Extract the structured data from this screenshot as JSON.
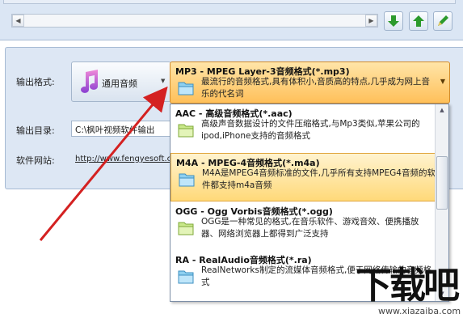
{
  "toolbar": {
    "icons": [
      "download-arrow-icon",
      "upload-arrow-icon",
      "edit-icon"
    ],
    "colors": {
      "green": "#2c9a2c"
    }
  },
  "settings": {
    "output_format_label": "输出格式:",
    "output_format_value": "通用音频",
    "output_dir_label": "输出目录:",
    "output_dir_value": "C:\\枫叶视频软件输出",
    "website_label": "软件网站:",
    "website_value": "http://www.fengyesoft.c"
  },
  "dropdown": {
    "selected": {
      "title": "MP3 - MPEG Layer-3音频格式(*.mp3)",
      "description": "最流行的音频格式,具有体积小,音质高的特点,几乎成为网上音乐的代名词"
    },
    "items": [
      {
        "title": "AAC - 高级音频格式(*.aac)",
        "description": "高级声音数据设计的文件压缩格式,与Mp3类似,苹果公司的ipod,iPhone支持的音频格式"
      },
      {
        "title": "M4A - MPEG-4音频格式(*.m4a)",
        "description": "M4A是MPEG4音频标准的文件,几乎所有支持MPEG4音频的软件都支持m4a音频"
      },
      {
        "title": "OGG - Ogg Vorbis音频格式(*.ogg)",
        "description": "OGG是一种常见的格式,在音乐软件、游戏音效、便携播放器、网络浏览器上都得到广泛支持"
      },
      {
        "title": "RA - RealAudio音频格式(*.ra)",
        "description": "RealNetworks制定的流媒体音频格式,便于网络传输的音频格式"
      }
    ]
  },
  "watermark": {
    "main": "下载吧",
    "url": "www.xiazaiba.com"
  },
  "colors": {
    "highlight": "#ffc05a",
    "arrow": "#d42121"
  }
}
